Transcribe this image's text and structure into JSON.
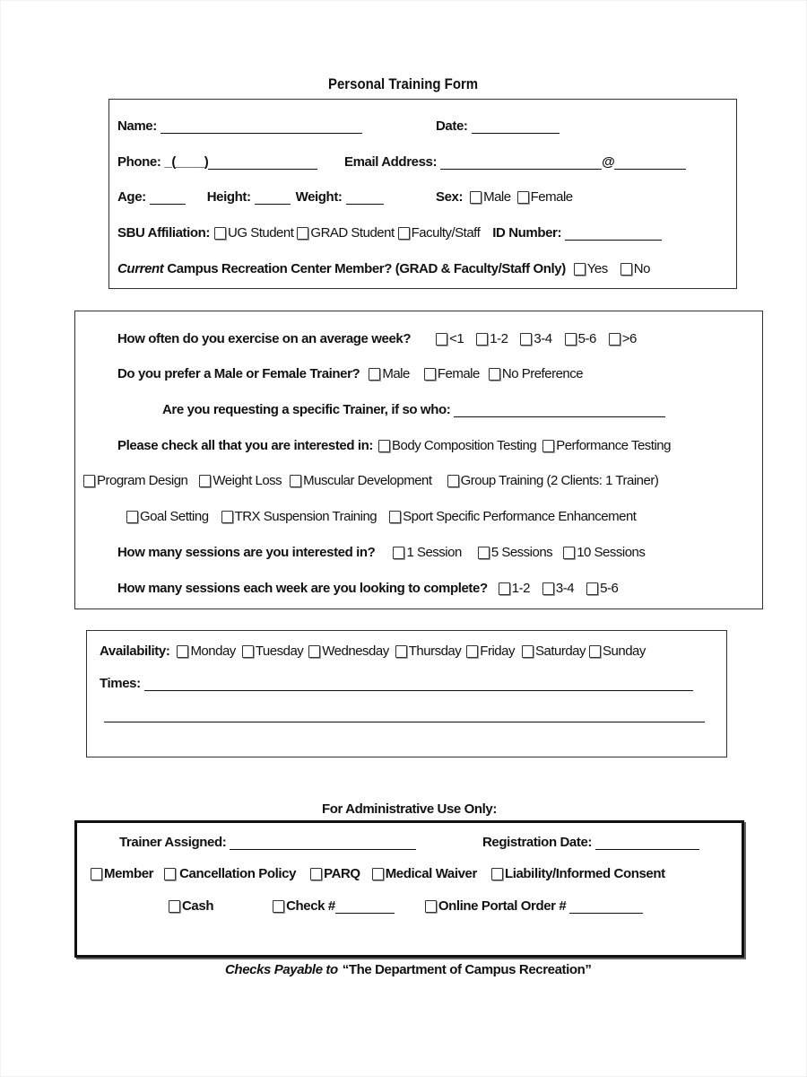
{
  "form": {
    "title": "Personal Training Form",
    "personal": {
      "name_label": "Name:",
      "date_label": "Date:",
      "phone_label": "Phone:",
      "phone_prefix": "_(____)",
      "email_label": "Email Address:",
      "email_at": "@",
      "age_label": "Age:",
      "height_label": "Height:",
      "weight_label": "Weight:",
      "sex_label": "Sex:",
      "sex_options": [
        "Male",
        "Female"
      ],
      "affiliation_label": "SBU Affiliation:",
      "affiliation_options": [
        "UG Student",
        "GRAD Student",
        "Faculty/Staff"
      ],
      "id_label": "ID Number:",
      "member_label_italic": "Current",
      "member_label_rest": "Campus Recreation Center Member? (GRAD & Faculty/Staff Only)",
      "member_options": [
        "Yes",
        "No"
      ]
    },
    "preferences": {
      "frequency_label": "How often do you exercise on an average week?",
      "frequency_options": [
        "<1",
        "1-2",
        "3-4",
        "5-6",
        ">6"
      ],
      "trainer_gender_label": "Do you prefer a Male or Female Trainer?",
      "trainer_gender_options": [
        "Male",
        "Female",
        "No Preference"
      ],
      "specific_trainer_label": "Are you requesting a specific Trainer, if so who:",
      "interests_label": "Please check all that you are interested in:",
      "interests_row1": [
        "Body Composition Testing",
        "Performance Testing"
      ],
      "interests_row2": [
        "Program Design",
        "Weight Loss",
        "Muscular Development",
        "Group Training (2 Clients: 1 Trainer)"
      ],
      "interests_row3": [
        "Goal Setting",
        "TRX Suspension Training",
        "Sport Specific Performance Enhancement"
      ],
      "sessions_label": "How many sessions are you interested in?",
      "sessions_options": [
        "1 Session",
        "5 Sessions",
        "10 Sessions"
      ],
      "weekly_label": "How many sessions each week are you looking to complete?",
      "weekly_options": [
        "1-2",
        "3-4",
        "5-6"
      ]
    },
    "availability": {
      "label": "Availability:",
      "days": [
        "Monday",
        "Tuesday",
        "Wednesday",
        "Thursday",
        "Friday",
        "Saturday",
        "Sunday"
      ],
      "times_label": "Times:"
    },
    "admin": {
      "heading": "For Administrative Use Only:",
      "trainer_label": "Trainer Assigned:",
      "registration_label": "Registration Date:",
      "checklist": [
        "Member",
        "Cancellation Policy",
        "PARQ",
        "Medical Waiver",
        "Liability/Informed Consent"
      ],
      "payment": [
        "Cash",
        "Check #",
        "Online Portal Order #"
      ]
    },
    "footer": {
      "italic": "Checks Payable to",
      "rest": "“The Department of Campus Recreation”"
    }
  }
}
